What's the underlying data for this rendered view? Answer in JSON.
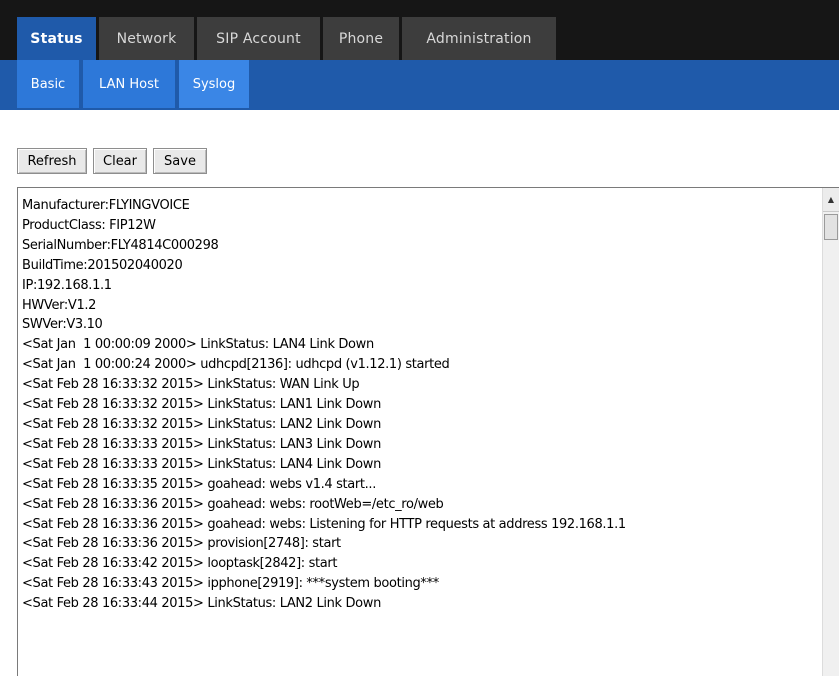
{
  "top_tabs": [
    {
      "label": "Status",
      "active": true
    },
    {
      "label": "Network",
      "active": false
    },
    {
      "label": "SIP Account",
      "active": false
    },
    {
      "label": "Phone",
      "active": false
    },
    {
      "label": "Administration",
      "active": false
    }
  ],
  "sub_tabs": [
    {
      "label": "Basic",
      "active": false
    },
    {
      "label": "LAN Host",
      "active": false
    },
    {
      "label": "Syslog",
      "active": true
    }
  ],
  "buttons": {
    "refresh": "Refresh",
    "clear": "Clear",
    "save": "Save"
  },
  "log_lines": [
    "Manufacturer:FLYINGVOICE",
    "ProductClass: FIP12W",
    "SerialNumber:FLY4814C000298",
    "BuildTime:201502040020",
    "IP:192.168.1.1",
    "HWVer:V1.2",
    "SWVer:V3.10",
    "<Sat Jan  1 00:00:09 2000> LinkStatus: LAN4 Link Down",
    "<Sat Jan  1 00:00:24 2000> udhcpd[2136]: udhcpd (v1.12.1) started",
    "<Sat Feb 28 16:33:32 2015> LinkStatus: WAN Link Up",
    "<Sat Feb 28 16:33:32 2015> LinkStatus: LAN1 Link Down",
    "<Sat Feb 28 16:33:32 2015> LinkStatus: LAN2 Link Down",
    "<Sat Feb 28 16:33:33 2015> LinkStatus: LAN3 Link Down",
    "<Sat Feb 28 16:33:33 2015> LinkStatus: LAN4 Link Down",
    "<Sat Feb 28 16:33:35 2015> goahead: webs v1.4 start...",
    "<Sat Feb 28 16:33:36 2015> goahead: webs: rootWeb=/etc_ro/web",
    "<Sat Feb 28 16:33:36 2015> goahead: webs: Listening for HTTP requests at address 192.168.1.1",
    "<Sat Feb 28 16:33:36 2015> provision[2748]: start",
    "<Sat Feb 28 16:33:42 2015> looptask[2842]: start",
    "<Sat Feb 28 16:33:43 2015> ipphone[2919]: ***system booting***",
    "<Sat Feb 28 16:33:44 2015> LinkStatus: LAN2 Link Down"
  ],
  "icons": {
    "scroll_up": "triangle-up-icon"
  }
}
